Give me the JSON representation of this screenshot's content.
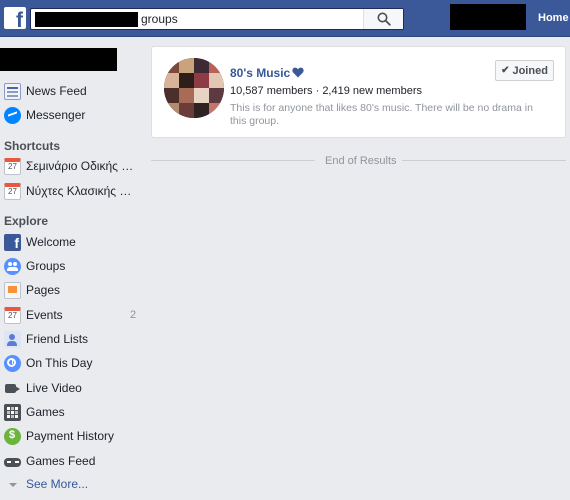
{
  "topbar": {
    "logo_letter": "f",
    "search_value": "groups",
    "home_label": "Home"
  },
  "sidebar": {
    "top_items": [
      {
        "label": "News Feed",
        "icon": "news-feed-icon"
      },
      {
        "label": "Messenger",
        "icon": "messenger-icon"
      }
    ],
    "shortcuts_title": "Shortcuts",
    "shortcuts": [
      {
        "label": "Σεμινάριο Οδικής Σ...",
        "icon": "calendar-icon",
        "icon_text": "27"
      },
      {
        "label": "Νύχτες Κλασικής Μ...",
        "icon": "calendar-icon",
        "icon_text": "27"
      }
    ],
    "explore_title": "Explore",
    "explore": [
      {
        "label": "Welcome",
        "icon": "facebook-icon"
      },
      {
        "label": "Groups",
        "icon": "groups-icon"
      },
      {
        "label": "Pages",
        "icon": "pages-icon"
      },
      {
        "label": "Events",
        "icon": "calendar-icon",
        "icon_text": "27",
        "count": "2"
      },
      {
        "label": "Friend Lists",
        "icon": "friend-lists-icon"
      },
      {
        "label": "On This Day",
        "icon": "on-this-day-icon"
      },
      {
        "label": "Live Video",
        "icon": "live-video-icon"
      },
      {
        "label": "Games",
        "icon": "games-icon"
      },
      {
        "label": "Payment History",
        "icon": "payment-history-icon"
      },
      {
        "label": "Games Feed",
        "icon": "game-controller-icon"
      }
    ],
    "see_more": "See More..."
  },
  "result": {
    "group_name": "80's Music",
    "meta": "10,587 members · 2,419 new members",
    "description": "This is for anyone that likes 80's music. There will be no drama in this group.",
    "joined_label": "Joined",
    "check_glyph": "✔"
  },
  "end_of_results": "End of Results",
  "colors": {
    "brand": "#3b5998",
    "link": "#365899",
    "background": "#e9ebee"
  }
}
